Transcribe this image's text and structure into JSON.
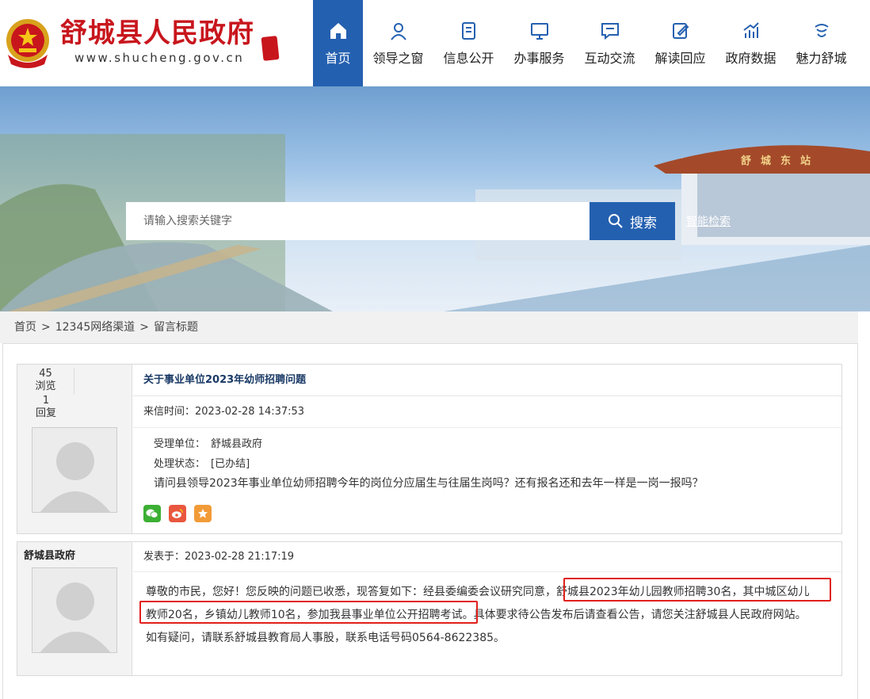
{
  "header": {
    "site_title": "舒城县人民政府",
    "site_domain": "www.shucheng.gov.cn",
    "nav": [
      {
        "label": "首页",
        "icon": "home-icon",
        "active": true
      },
      {
        "label": "领导之窗",
        "icon": "user-icon"
      },
      {
        "label": "信息公开",
        "icon": "document-icon"
      },
      {
        "label": "办事服务",
        "icon": "monitor-icon"
      },
      {
        "label": "互动交流",
        "icon": "chat-icon"
      },
      {
        "label": "解读回应",
        "icon": "edit-icon"
      },
      {
        "label": "政府数据",
        "icon": "chart-icon"
      },
      {
        "label": "魅力舒城",
        "icon": "lamp-icon"
      }
    ]
  },
  "banner": {
    "station_sign": "舒城东站",
    "search": {
      "placeholder": "请输入搜索关键字",
      "button_label": "搜索",
      "advanced_label": "智能检索"
    }
  },
  "breadcrumb": [
    "首页",
    "12345网络渠道",
    "留言标题"
  ],
  "post": {
    "views": "45",
    "views_label": "浏览",
    "replies": "1",
    "replies_label": "回复",
    "title": "关于事业单位2023年幼师招聘问题",
    "time": "来信时间：2023-02-28 14:37:53",
    "unit_label": "受理单位：",
    "unit": "舒城县政府",
    "status_label": "处理状态：",
    "status": "[已办结]",
    "question": "请问县领导2023年事业单位幼师招聘今年的岗位分应届生与往届生岗吗？还有报名还和去年一样是一岗一报吗？",
    "share": [
      "wechat-icon",
      "weibo-icon",
      "favorite-icon"
    ]
  },
  "reply": {
    "author": "舒城县政府",
    "time": "发表于：2023-02-28 21:17:19",
    "line1": "尊敬的市民，您好！您反映的问题已收悉，现答复如下：经县委编委会议研究同意，舒城县2023年幼儿园教师招聘30名，其中城区幼儿",
    "line2": "教师20名，乡镇幼儿教师10名，参加我县事业单位公开招聘考试。具体要求待公告发布后请查看公告，请您关注舒城县人民政府网站。",
    "line3": "如有疑问，请联系舒城县教育局人事股，联系电话号码0564-8622385。"
  },
  "colors": {
    "accent": "#2460b0",
    "brand_red": "#c8161d",
    "highlight": "#e0201c"
  }
}
